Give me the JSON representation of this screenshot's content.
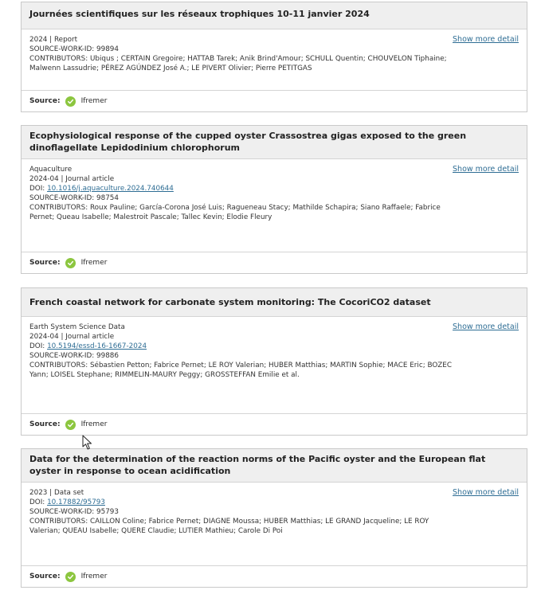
{
  "common": {
    "show_more": "Show more detail",
    "source_label": "Source:",
    "source_name": "Ifremer",
    "accent": "#2e6d94",
    "check_color": "#8cc63f"
  },
  "works": [
    {
      "title": "Journées scientifiques sur les réseaux trophiques 10-11 janvier 2024",
      "journal": "",
      "date_type": "2024 | Report",
      "doi_label": "",
      "doi": "",
      "source_work_id": "SOURCE-WORK-ID: 99894",
      "contributors": "CONTRIBUTORS: Ubiqus ; CERTAIN Gregoire; HATTAB Tarek; Anik Brind'Amour; SCHULL Quentin; CHOUVELON Tiphaine; Malwenn Lassudrie; PÉREZ AGÚNDEZ José A.; LE PIVERT Olivier; Pierre PETITGAS"
    },
    {
      "title": "Ecophysiological response of the cupped oyster Crassostrea gigas exposed to the green dinoflagellate Lepidodinium chlorophorum",
      "journal": "Aquaculture",
      "date_type": "2024-04 | Journal article",
      "doi_label": "DOI:",
      "doi": "10.1016/j.aquaculture.2024.740644",
      "source_work_id": "SOURCE-WORK-ID: 98754",
      "contributors": "CONTRIBUTORS: Roux Pauline; García-Corona José Luis; Ragueneau Stacy; Mathilde Schapira; Siano Raffaele; Fabrice Pernet; Queau Isabelle; Malestroit Pascale; Tallec Kevin; Elodie Fleury"
    },
    {
      "title": "French coastal network for carbonate system monitoring: The CocoriCO2 dataset",
      "journal": "Earth System Science Data",
      "date_type": "2024-04 | Journal article",
      "doi_label": "DOI:",
      "doi": "10.5194/essd-16-1667-2024",
      "source_work_id": "SOURCE-WORK-ID: 99886",
      "contributors": "CONTRIBUTORS: Sébastien Petton; Fabrice Pernet; LE ROY Valerian; HUBER Matthias; MARTIN Sophie; MACE Eric; BOZEC Yann; LOISEL Stephane; RIMMELIN-MAURY Peggy; GROSSTEFFAN Emilie et al."
    },
    {
      "title": "Data for the determination of the reaction norms of the Pacific oyster and the European flat oyster in response to ocean acidification",
      "journal": "",
      "date_type": "2023 | Data set",
      "doi_label": "DOI:",
      "doi": "10.17882/95793",
      "source_work_id": "SOURCE-WORK-ID: 95793",
      "contributors": "CONTRIBUTORS: CAILLON Coline; Fabrice Pernet; DIAGNE Moussa; HUBER Matthias; LE GRAND Jacqueline; LE ROY Valerian; QUEAU Isabelle; QUERE Claudie; LUTIER Mathieu; Carole Di Poi"
    }
  ]
}
